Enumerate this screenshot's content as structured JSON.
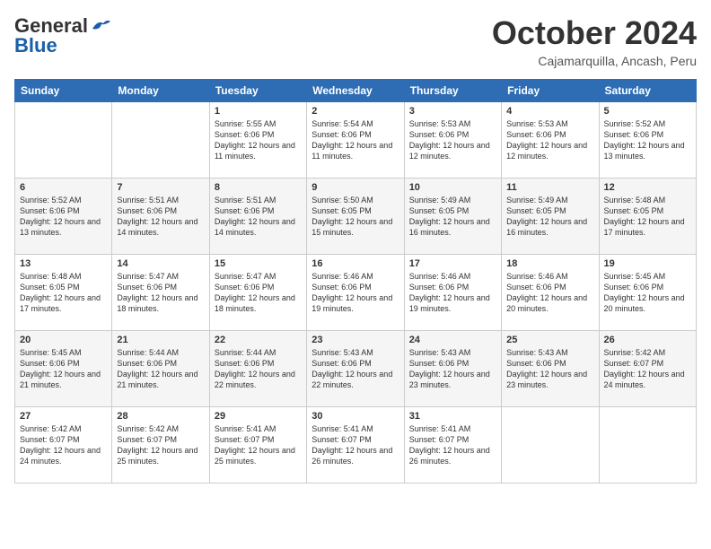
{
  "logo": {
    "line1": "General",
    "line2": "Blue"
  },
  "title": "October 2024",
  "subtitle": "Cajamarquilla, Ancash, Peru",
  "days_of_week": [
    "Sunday",
    "Monday",
    "Tuesday",
    "Wednesday",
    "Thursday",
    "Friday",
    "Saturday"
  ],
  "weeks": [
    [
      {
        "day": "",
        "info": ""
      },
      {
        "day": "",
        "info": ""
      },
      {
        "day": "1",
        "info": "Sunrise: 5:55 AM\nSunset: 6:06 PM\nDaylight: 12 hours and 11 minutes."
      },
      {
        "day": "2",
        "info": "Sunrise: 5:54 AM\nSunset: 6:06 PM\nDaylight: 12 hours and 11 minutes."
      },
      {
        "day": "3",
        "info": "Sunrise: 5:53 AM\nSunset: 6:06 PM\nDaylight: 12 hours and 12 minutes."
      },
      {
        "day": "4",
        "info": "Sunrise: 5:53 AM\nSunset: 6:06 PM\nDaylight: 12 hours and 12 minutes."
      },
      {
        "day": "5",
        "info": "Sunrise: 5:52 AM\nSunset: 6:06 PM\nDaylight: 12 hours and 13 minutes."
      }
    ],
    [
      {
        "day": "6",
        "info": "Sunrise: 5:52 AM\nSunset: 6:06 PM\nDaylight: 12 hours and 13 minutes."
      },
      {
        "day": "7",
        "info": "Sunrise: 5:51 AM\nSunset: 6:06 PM\nDaylight: 12 hours and 14 minutes."
      },
      {
        "day": "8",
        "info": "Sunrise: 5:51 AM\nSunset: 6:06 PM\nDaylight: 12 hours and 14 minutes."
      },
      {
        "day": "9",
        "info": "Sunrise: 5:50 AM\nSunset: 6:05 PM\nDaylight: 12 hours and 15 minutes."
      },
      {
        "day": "10",
        "info": "Sunrise: 5:49 AM\nSunset: 6:05 PM\nDaylight: 12 hours and 16 minutes."
      },
      {
        "day": "11",
        "info": "Sunrise: 5:49 AM\nSunset: 6:05 PM\nDaylight: 12 hours and 16 minutes."
      },
      {
        "day": "12",
        "info": "Sunrise: 5:48 AM\nSunset: 6:05 PM\nDaylight: 12 hours and 17 minutes."
      }
    ],
    [
      {
        "day": "13",
        "info": "Sunrise: 5:48 AM\nSunset: 6:05 PM\nDaylight: 12 hours and 17 minutes."
      },
      {
        "day": "14",
        "info": "Sunrise: 5:47 AM\nSunset: 6:06 PM\nDaylight: 12 hours and 18 minutes."
      },
      {
        "day": "15",
        "info": "Sunrise: 5:47 AM\nSunset: 6:06 PM\nDaylight: 12 hours and 18 minutes."
      },
      {
        "day": "16",
        "info": "Sunrise: 5:46 AM\nSunset: 6:06 PM\nDaylight: 12 hours and 19 minutes."
      },
      {
        "day": "17",
        "info": "Sunrise: 5:46 AM\nSunset: 6:06 PM\nDaylight: 12 hours and 19 minutes."
      },
      {
        "day": "18",
        "info": "Sunrise: 5:46 AM\nSunset: 6:06 PM\nDaylight: 12 hours and 20 minutes."
      },
      {
        "day": "19",
        "info": "Sunrise: 5:45 AM\nSunset: 6:06 PM\nDaylight: 12 hours and 20 minutes."
      }
    ],
    [
      {
        "day": "20",
        "info": "Sunrise: 5:45 AM\nSunset: 6:06 PM\nDaylight: 12 hours and 21 minutes."
      },
      {
        "day": "21",
        "info": "Sunrise: 5:44 AM\nSunset: 6:06 PM\nDaylight: 12 hours and 21 minutes."
      },
      {
        "day": "22",
        "info": "Sunrise: 5:44 AM\nSunset: 6:06 PM\nDaylight: 12 hours and 22 minutes."
      },
      {
        "day": "23",
        "info": "Sunrise: 5:43 AM\nSunset: 6:06 PM\nDaylight: 12 hours and 22 minutes."
      },
      {
        "day": "24",
        "info": "Sunrise: 5:43 AM\nSunset: 6:06 PM\nDaylight: 12 hours and 23 minutes."
      },
      {
        "day": "25",
        "info": "Sunrise: 5:43 AM\nSunset: 6:06 PM\nDaylight: 12 hours and 23 minutes."
      },
      {
        "day": "26",
        "info": "Sunrise: 5:42 AM\nSunset: 6:07 PM\nDaylight: 12 hours and 24 minutes."
      }
    ],
    [
      {
        "day": "27",
        "info": "Sunrise: 5:42 AM\nSunset: 6:07 PM\nDaylight: 12 hours and 24 minutes."
      },
      {
        "day": "28",
        "info": "Sunrise: 5:42 AM\nSunset: 6:07 PM\nDaylight: 12 hours and 25 minutes."
      },
      {
        "day": "29",
        "info": "Sunrise: 5:41 AM\nSunset: 6:07 PM\nDaylight: 12 hours and 25 minutes."
      },
      {
        "day": "30",
        "info": "Sunrise: 5:41 AM\nSunset: 6:07 PM\nDaylight: 12 hours and 26 minutes."
      },
      {
        "day": "31",
        "info": "Sunrise: 5:41 AM\nSunset: 6:07 PM\nDaylight: 12 hours and 26 minutes."
      },
      {
        "day": "",
        "info": ""
      },
      {
        "day": "",
        "info": ""
      }
    ]
  ]
}
